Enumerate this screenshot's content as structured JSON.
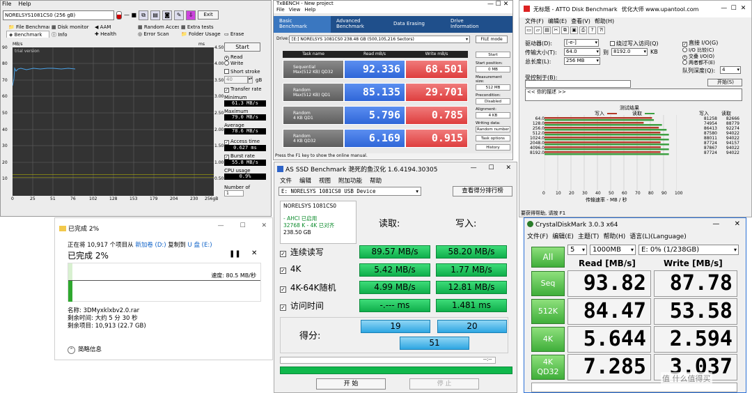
{
  "hdtune": {
    "menu": [
      "File",
      "Help"
    ],
    "drive": "NORELSYS1081CS0 (256 gB)",
    "exit": "Exit",
    "tabs": [
      "File Benchmark",
      "Disk monitor",
      "AAM",
      "Random Access",
      "Extra tests",
      "Benchmark",
      "Info",
      "Health",
      "Error Scan",
      "Folder Usage",
      "Erase"
    ],
    "trial": "trial version",
    "y_left_unit": "MB/s",
    "y_right_unit": "ms",
    "y_left_ticks": [
      "90",
      "80",
      "70",
      "60",
      "50",
      "40",
      "30",
      "20",
      "10"
    ],
    "y_right_ticks": [
      "4.50",
      "4.00",
      "3.50",
      "3.00",
      "2.50",
      "2.00",
      "1.50",
      "1.00",
      "0.50"
    ],
    "x_ticks": [
      "0",
      "25",
      "51",
      "76",
      "102",
      "128",
      "153",
      "179",
      "204",
      "230",
      "256gB"
    ],
    "start": "Start",
    "read": "Read",
    "write": "Write",
    "short_stroke": "Short stroke",
    "stroke_value": "40",
    "stroke_unit": "gB",
    "transfer_rate": "Transfer rate",
    "minimum_label": "Minimum",
    "minimum": "61.3 MB/s",
    "maximum_label": "Maximum",
    "maximum": "79.0 MB/s",
    "average_label": "Average",
    "average": "78.6 MB/s",
    "access_time_label": "Access time",
    "access_time": "0.627 ms",
    "burst_rate_label": "Burst rate",
    "burst_rate": "55.8 MB/s",
    "cpu_usage_label": "CPU usage",
    "cpu_usage": "0.9%",
    "number_of_label": "Number of",
    "number_of_value": "1"
  },
  "txbench": {
    "title": "TxBENCH - New project",
    "menu": [
      "File",
      "View",
      "Help"
    ],
    "tabs": [
      {
        "l1": "Basic",
        "l2": "Benchmark"
      },
      {
        "l1": "Advanced",
        "l2": "Benchmark"
      },
      {
        "l1": "Data Erasing",
        "l2": ""
      },
      {
        "l1": "Drive",
        "l2": "Information"
      }
    ],
    "drive_label": "Drive:",
    "drive": "[E:] NORELSYS 1081CS0  238.48 GB (500,105,216 Sectors)",
    "file_mode": "FILE mode",
    "headers": [
      "Task name",
      "Read mB/s",
      "Write mB/s"
    ],
    "rows": [
      {
        "n1": "Sequential",
        "n2": "Max(512 KB) QD32",
        "read": "92.336",
        "write": "68.501"
      },
      {
        "n1": "Random",
        "n2": "Max(512 KB) QD1",
        "read": "85.135",
        "write": "29.701"
      },
      {
        "n1": "Random",
        "n2": "4 KB QD1",
        "read": "5.796",
        "write": "0.785"
      },
      {
        "n1": "Random",
        "n2": "4 KB QD32",
        "read": "6.169",
        "write": "0.915"
      }
    ],
    "start": "Start",
    "start_position_label": "Start position:",
    "start_position": "0 MB",
    "measurement_size_label": "Measurement size:",
    "measurement_size": "512 MB",
    "precondition_label": "Precondition:",
    "precondition": "Disabled",
    "alignment_label": "Alignment:",
    "alignment": "4 KB",
    "writing_data_label": "Writing data:",
    "writing_data": "Random number",
    "task_options": "Task options",
    "history": "History",
    "status": "Press the F1 key to show the online manual."
  },
  "atto": {
    "title": "无标题 - ATTO Disk Benchmark",
    "watermark": "优化大师 www.upantool.com",
    "menu": [
      "文件(F)",
      "编辑(E)",
      "查看(V)",
      "帮助(H)"
    ],
    "drive_label": "驱动器(D):",
    "drive": "[-e-]",
    "bypass": "绕过写入访问(Q)",
    "transfer_label": "传输大小(T):",
    "transfer_from": "64.0",
    "to_label": "到",
    "transfer_to": "8192.0",
    "kb": "KB",
    "total_label": "总长度(L):",
    "total": "256 MB",
    "direct_io": "直接 I/O(G)",
    "io_compare": "I/O 比较(C)",
    "overlap_io": "交叠 I/O(O)",
    "neither": "两者都不(E)",
    "queue_label": "队列深度(Q):",
    "queue": "4",
    "control_label": "受控制于(B):",
    "description": "<<   你的描述   >>",
    "start": "开始(S)",
    "results_title": "测试结果",
    "legend_write": "写入",
    "legend_read": "读取",
    "col_write": "写入",
    "col_read": "读取",
    "xlabel": "传输速率 - MB / 秒",
    "x_ticks": [
      "0",
      "10",
      "20",
      "30",
      "40",
      "50",
      "60",
      "70",
      "80",
      "90",
      "100"
    ],
    "status": "要获得帮助, 请按 F1",
    "colors": {
      "write": "#b33a2a",
      "read": "#3ea043"
    }
  },
  "atto_chart": {
    "type": "bar",
    "categories": [
      "64.0",
      "128.0",
      "256.0",
      "512.0",
      "1024.0",
      "2048.0",
      "4096.0",
      "8192.0"
    ],
    "series": [
      {
        "name": "写入",
        "values": [
          81258,
          74954,
          86413,
          87580,
          88011,
          87724,
          87867,
          87724
        ]
      },
      {
        "name": "读取",
        "values": [
          82666,
          88779,
          92274,
          94022,
          94022,
          94157,
          94022,
          94022
        ]
      }
    ],
    "xlabel": "传输速率 - MB / 秒",
    "ylim": [
      0,
      100
    ]
  },
  "copy": {
    "title": "已完成 2%",
    "info_prefix": "正在将 10,917 个项目从 ",
    "src": "新加卷 (D:)",
    "mid": " 复制到 ",
    "dst": "U 盘 (E:)",
    "percent": "已完成 2%",
    "progress": 0.02,
    "speed": "速度: 80.5 MB/秒",
    "name": "名称: 3DMyxklxbv2.0.rar",
    "remaining_time": "剩余时间: 大约 5 分 30 秒",
    "remaining_items": "剩余项目: 10,913 (22.7 GB)",
    "less_info": "简略信息"
  },
  "asssd": {
    "title": "AS SSD Benchmark 滟死的鱼汉化 1.6.4194.30305",
    "menu": [
      "文件",
      "编辑",
      "视图",
      "附加功能",
      "帮助"
    ],
    "drive": "E: NORELSYS 1081CS0 USB Device",
    "ranking": "查看得分排行榜",
    "dev_name": "NORELSYS 1081CS0",
    "ahci": "- AHCI 已启用",
    "align": "32768 K - 4K 已对齐",
    "size": "238.50 GB",
    "read_hdr": "读取:",
    "write_hdr": "写入:",
    "rows": [
      {
        "label": "连续读写",
        "read": "89.57 MB/s",
        "write": "58.20 MB/s"
      },
      {
        "label": "4K",
        "read": "5.42 MB/s",
        "write": "1.77 MB/s"
      },
      {
        "label": "4K-64K随机",
        "read": "4.99 MB/s",
        "write": "12.81 MB/s"
      },
      {
        "label": "访问时间",
        "read": "-.--- ms",
        "write": "1.481 ms"
      }
    ],
    "score_label": "得分:",
    "score_read": "19",
    "score_write": "20",
    "score_total": "51",
    "timer": "--:--",
    "start": "开 始",
    "stop": "停 止"
  },
  "cdm": {
    "title": "CrystalDiskMark 3.0.3 x64",
    "menu": [
      "文件(F)",
      "编辑(E)",
      "主题(T)",
      "帮助(H)",
      "语言(L)(Language)"
    ],
    "count": "5",
    "size": "1000MB",
    "drive": "E: 0% (1/238GB)",
    "all": "All",
    "read_hdr": "Read [MB/s]",
    "write_hdr": "Write [MB/s]",
    "rows": [
      {
        "l1": "Seq",
        "l2": "",
        "read": "93.82",
        "write": "87.78"
      },
      {
        "l1": "512K",
        "l2": "",
        "read": "84.47",
        "write": "53.58"
      },
      {
        "l1": "4K",
        "l2": "",
        "read": "5.644",
        "write": "2.594"
      },
      {
        "l1": "4K",
        "l2": "QD32",
        "read": "7.285",
        "write": "3.037"
      }
    ],
    "watermark": "值 什么值得买"
  }
}
